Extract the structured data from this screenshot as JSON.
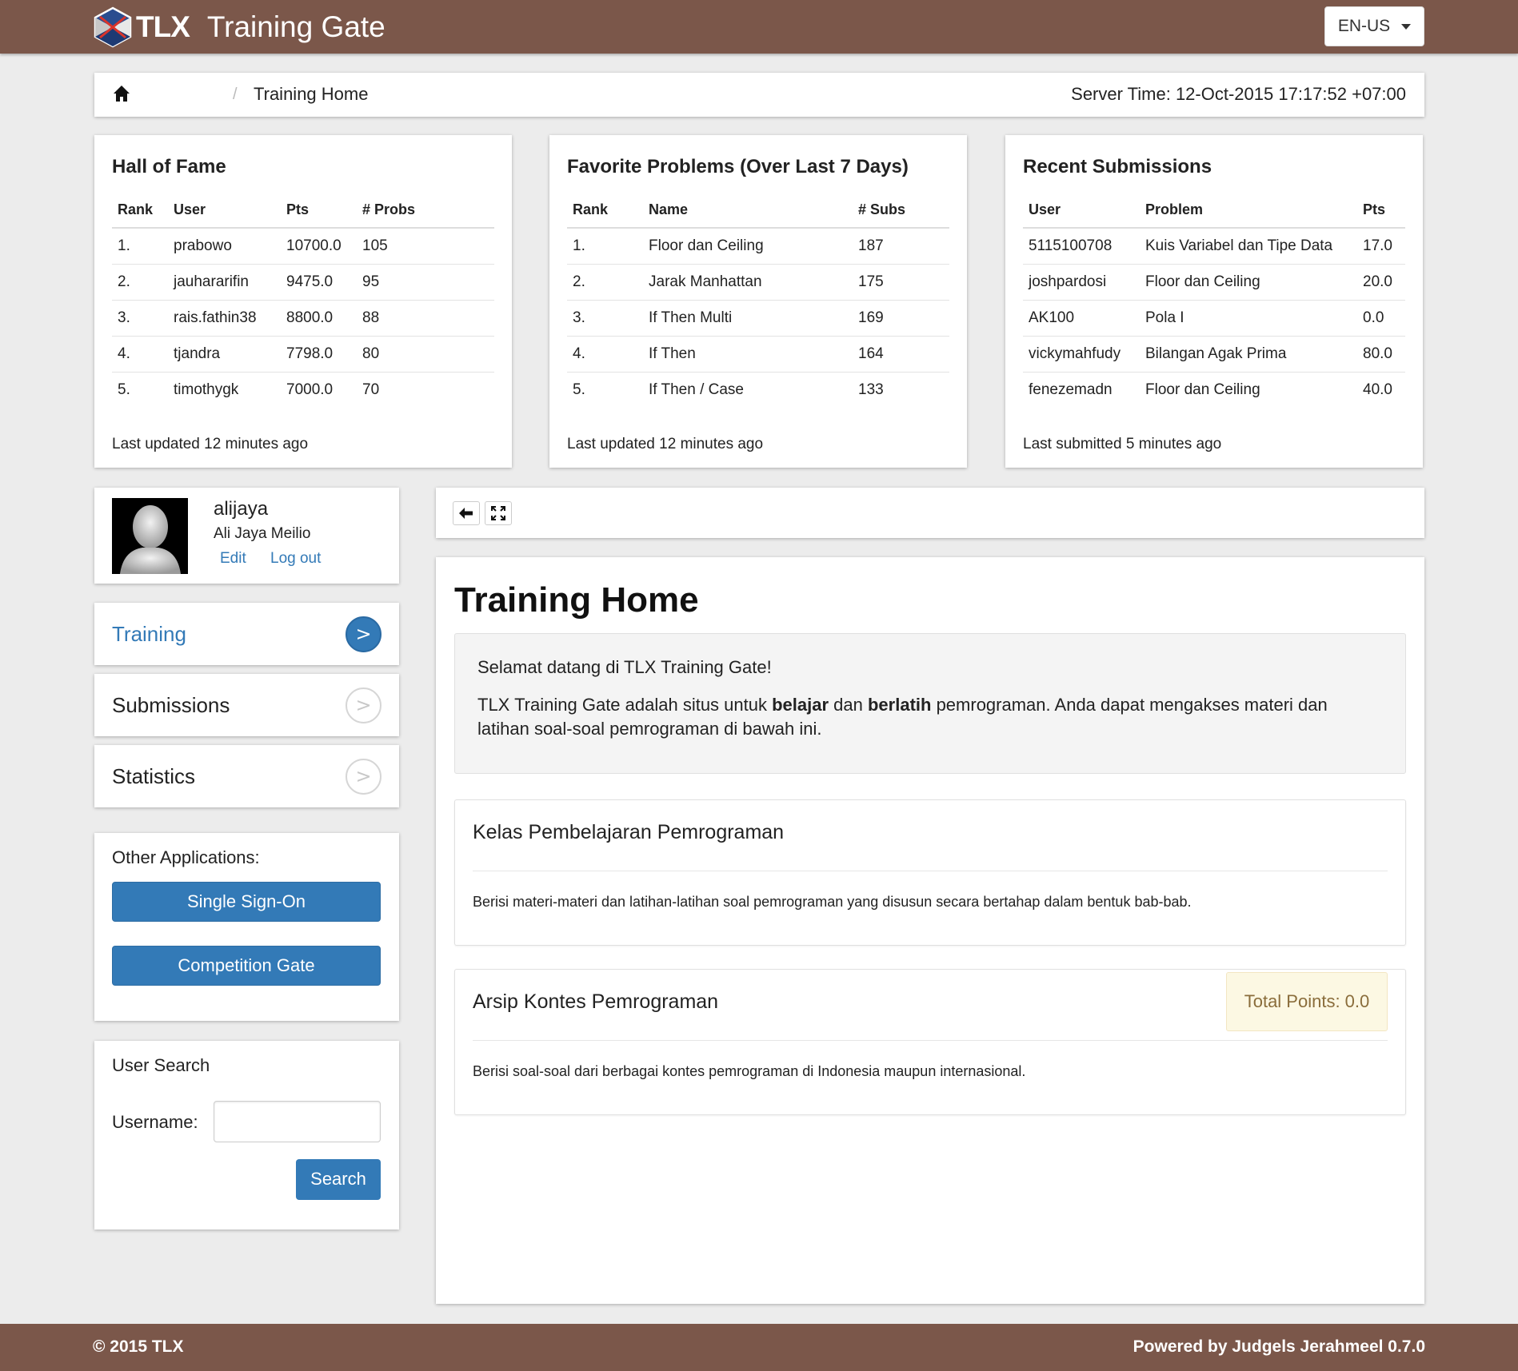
{
  "header": {
    "logo_text": "TLX",
    "app_title": "Training Gate",
    "language": "EN-US"
  },
  "breadcrumb": {
    "page": "Training Home",
    "server_time": "Server Time: 12-Oct-2015 17:17:52 +07:00"
  },
  "hall_of_fame": {
    "title": "Hall of Fame",
    "columns": [
      "Rank",
      "User",
      "Pts",
      "# Probs"
    ],
    "rows": [
      [
        "1.",
        "prabowo",
        "10700.0",
        "105"
      ],
      [
        "2.",
        "jauhararifin",
        "9475.0",
        "95"
      ],
      [
        "3.",
        "rais.fathin38",
        "8800.0",
        "88"
      ],
      [
        "4.",
        "tjandra",
        "7798.0",
        "80"
      ],
      [
        "5.",
        "timothygk",
        "7000.0",
        "70"
      ]
    ],
    "footer": "Last updated 12 minutes ago"
  },
  "favorite_problems": {
    "title": "Favorite Problems (Over Last 7 Days)",
    "columns": [
      "Rank",
      "Name",
      "# Subs"
    ],
    "rows": [
      [
        "1.",
        "Floor dan Ceiling",
        "187"
      ],
      [
        "2.",
        "Jarak Manhattan",
        "175"
      ],
      [
        "3.",
        "If Then Multi",
        "169"
      ],
      [
        "4.",
        "If Then",
        "164"
      ],
      [
        "5.",
        "If Then / Case",
        "133"
      ]
    ],
    "footer": "Last updated 12 minutes ago"
  },
  "recent_submissions": {
    "title": "Recent Submissions",
    "columns": [
      "User",
      "Problem",
      "Pts"
    ],
    "rows": [
      [
        "5115100708",
        "Kuis Variabel dan Tipe Data",
        "17.0"
      ],
      [
        "joshpardosi",
        "Floor dan Ceiling",
        "20.0"
      ],
      [
        "AK100",
        "Pola I",
        "0.0"
      ],
      [
        "vickymahfudy",
        "Bilangan Agak Prima",
        "80.0"
      ],
      [
        "fenezemadn",
        "Floor dan Ceiling",
        "40.0"
      ]
    ],
    "footer": "Last submitted 5 minutes ago"
  },
  "profile": {
    "username": "alijaya",
    "full_name": "Ali Jaya Meilio",
    "edit_label": "Edit",
    "logout_label": "Log out"
  },
  "menu": {
    "training": "Training",
    "submissions": "Submissions",
    "statistics": "Statistics",
    "arrow_glyph": ">"
  },
  "other_apps": {
    "label": "Other Applications:",
    "sso": "Single Sign-On",
    "competition": "Competition Gate"
  },
  "user_search": {
    "title": "User Search",
    "username_label": "Username:",
    "username_value": "",
    "button": "Search"
  },
  "main": {
    "title": "Training Home",
    "welcome_line": "Selamat datang di TLX Training Gate!",
    "intro_pre": "TLX Training Gate adalah situs untuk ",
    "intro_bold1": "belajar",
    "intro_mid": " dan ",
    "intro_bold2": "berlatih",
    "intro_post": " pemrograman. Anda dapat mengakses materi dan latihan soal-soal pemrograman di bawah ini.",
    "sections": [
      {
        "title": "Kelas Pembelajaran Pemrograman",
        "description": "Berisi materi-materi dan latihan-latihan soal pemrograman yang disusun secara bertahap dalam bentuk bab-bab."
      },
      {
        "title": "Arsip Kontes Pemrograman",
        "description": "Berisi soal-soal dari berbagai kontes pemrograman di Indonesia maupun internasional.",
        "points": "Total Points: 0.0"
      }
    ]
  },
  "footer": {
    "copyright": "© 2015 TLX",
    "powered": "Powered by Judgels Jerahmeel 0.7.0"
  },
  "colors": {
    "brand_brown": "#7b574a",
    "primary_blue": "#337ab7",
    "points_bg": "#fcf8e3"
  },
  "icons": [
    "tlx-logo-icon",
    "home-icon",
    "back-arrow-icon",
    "fullscreen-icon",
    "avatar-silhouette-icon",
    "chevron-right-icon"
  ]
}
